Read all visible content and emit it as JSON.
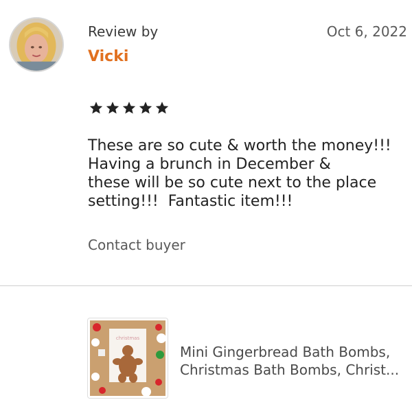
{
  "review": {
    "by_label": "Review by",
    "reviewer_name": "Vicki",
    "date": "Oct 6, 2022",
    "rating": 5,
    "rating_max": 5,
    "text": "These are so cute & worth the money!!!\nHaving a brunch in December &\nthese will be so cute next to the place\nsetting!!!  Fantastic item!!!",
    "contact_label": "Contact buyer"
  },
  "product": {
    "title_line1": "Mini Gingerbread Bath Bombs,",
    "title_line2": "Christmas Bath Bombs, Christ...",
    "image_icon": "gingerbread-product-image",
    "image_card_text": "christmas"
  },
  "colors": {
    "reviewer_name": "#e1701f",
    "star": "#222222",
    "divider": "#cfcfcf"
  }
}
